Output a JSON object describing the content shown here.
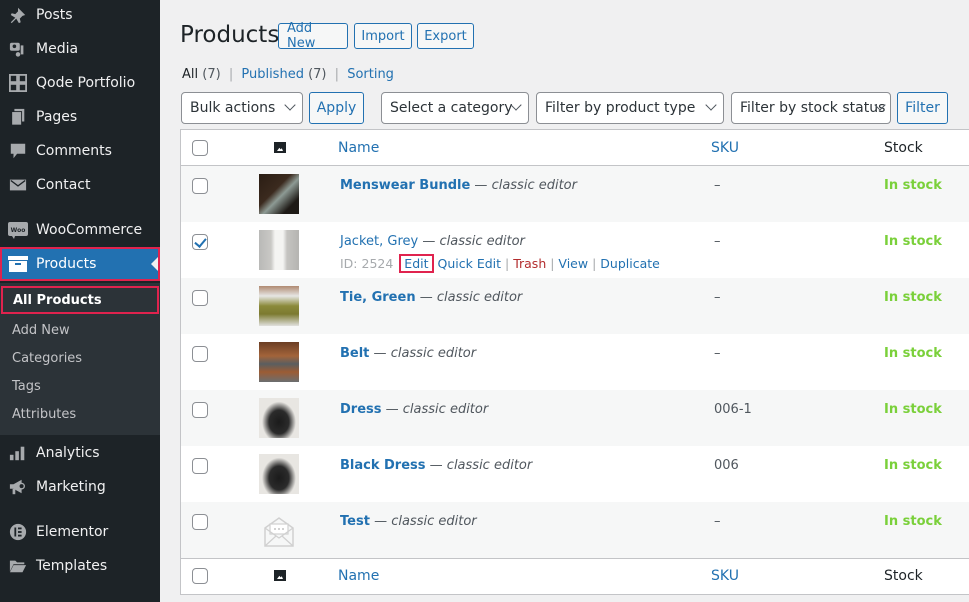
{
  "sidebar": {
    "items": [
      {
        "label": "Posts",
        "icon": "pin-icon"
      },
      {
        "label": "Media",
        "icon": "media-icon"
      },
      {
        "label": "Qode Portfolio",
        "icon": "grid-icon"
      },
      {
        "label": "Pages",
        "icon": "pages-icon"
      },
      {
        "label": "Comments",
        "icon": "comment-icon"
      },
      {
        "label": "Contact",
        "icon": "envelope-icon"
      },
      {
        "label": "WooCommerce",
        "icon": "woo-icon"
      },
      {
        "label": "Products",
        "icon": "archive-icon"
      },
      {
        "label": "Analytics",
        "icon": "bar-chart-icon"
      },
      {
        "label": "Marketing",
        "icon": "megaphone-icon"
      },
      {
        "label": "Elementor",
        "icon": "elementor-icon"
      },
      {
        "label": "Templates",
        "icon": "folder-icon"
      }
    ],
    "submenu": [
      "All Products",
      "Add New",
      "Categories",
      "Tags",
      "Attributes"
    ],
    "active_item": "Products",
    "current_submenu": "All Products"
  },
  "header": {
    "title": "Products",
    "buttons": {
      "add_new": "Add New",
      "import": "Import",
      "export": "Export"
    }
  },
  "views": {
    "all": "All",
    "all_count": "(7)",
    "published": "Published",
    "published_count": "(7)",
    "sorting": "Sorting",
    "sep": "|"
  },
  "filters": {
    "bulk_actions": "Bulk actions",
    "apply": "Apply",
    "category": "Select a category",
    "product_type": "Filter by product type",
    "stock_status": "Filter by stock status",
    "filter": "Filter"
  },
  "table": {
    "columns": {
      "name": "Name",
      "sku": "SKU",
      "stock": "Stock"
    },
    "rows": [
      {
        "name": "Menswear Bundle",
        "editor": "classic editor",
        "sku": "–",
        "stock": "In stock",
        "checked": false
      },
      {
        "name": "Jacket, Grey",
        "editor": "classic editor",
        "sku": "–",
        "stock": "In stock",
        "checked": true,
        "row_actions": {
          "id": "ID: 2524",
          "edit": "Edit",
          "quick_edit": "Quick Edit",
          "trash": "Trash",
          "view": "View",
          "duplicate": "Duplicate"
        }
      },
      {
        "name": "Tie, Green",
        "editor": "classic editor",
        "sku": "–",
        "stock": "In stock",
        "checked": false
      },
      {
        "name": "Belt",
        "editor": "classic editor",
        "sku": "–",
        "stock": "In stock",
        "checked": false
      },
      {
        "name": "Dress",
        "editor": "classic editor",
        "sku": "006-1",
        "stock": "In stock",
        "checked": false
      },
      {
        "name": "Black Dress",
        "editor": "classic editor",
        "sku": "006",
        "stock": "In stock",
        "checked": false
      },
      {
        "name": "Test",
        "editor": "classic editor",
        "sku": "–",
        "stock": "In stock",
        "checked": false
      }
    ],
    "dash": "—"
  },
  "colors": {
    "accent": "#2271b1",
    "instock": "#7ad03a",
    "highlight": "#e0234e",
    "trash": "#b32d2e"
  }
}
